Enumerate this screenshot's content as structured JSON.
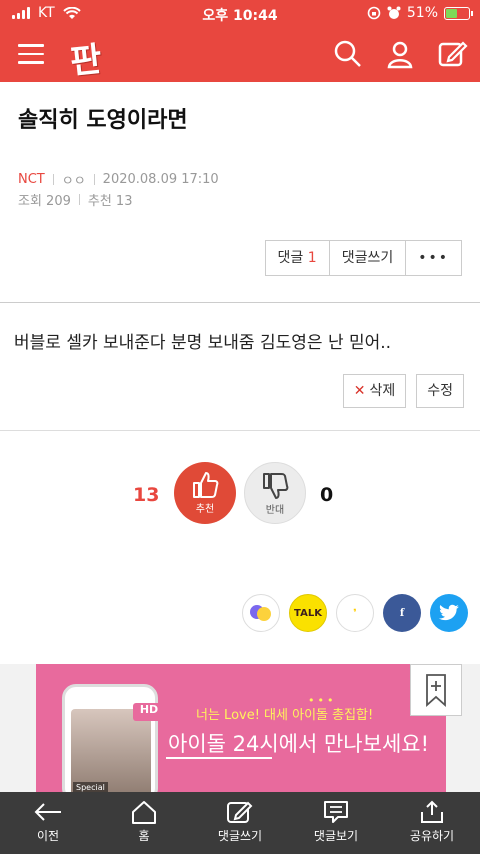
{
  "status_bar": {
    "carrier": "KT",
    "time": "오후 10:44",
    "battery": "51%",
    "battery_level": 0.51
  },
  "header": {
    "logo": "판"
  },
  "post": {
    "title": "솔직히 도영이라면",
    "category": "NCT",
    "author": "ㅇㅇ",
    "date": "2020.08.09 17:10",
    "views": "조회 209",
    "recommend": "추천 13",
    "body": "버블로 셀카 보내준다 분명 보내줌 김도영은 난 믿어.."
  },
  "comment_bar": {
    "comments_label": "댓글",
    "comments_count": "1",
    "write_label": "댓글쓰기",
    "more": "•••"
  },
  "edit_bar": {
    "delete_icon": "✕",
    "delete": "삭제",
    "edit": "수정"
  },
  "votes": {
    "up_count": "13",
    "up_label": "추천",
    "down_label": "반대",
    "down_count": "0"
  },
  "share": {
    "talk": "TALK",
    "story": "❜",
    "facebook": "f"
  },
  "ad": {
    "line1": "너는 Love! 대세 아이돌 총집합!",
    "line2": "아이돌 24시에서 만나보세요!",
    "badge": "HD",
    "phone_caption": "Special"
  },
  "toolbar": {
    "prev": "이전",
    "home": "홈",
    "write_comment": "댓글쓰기",
    "view_comments": "댓글보기",
    "share": "공유하기"
  },
  "colors": {
    "accent": "#e8473f",
    "toolbar": "#3b3b3b",
    "ad_bg": "#e86a9d"
  }
}
